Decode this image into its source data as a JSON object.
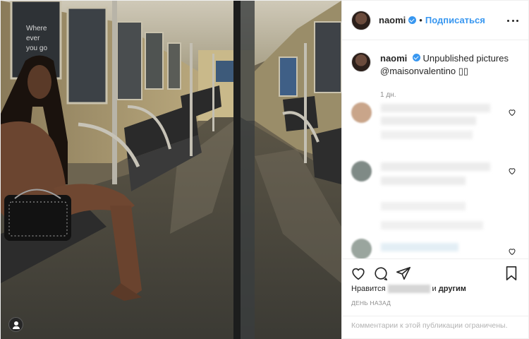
{
  "header": {
    "username": "naomi",
    "follow_label": "Подписаться",
    "dot": "•"
  },
  "caption": {
    "username": "naomi",
    "text": "Unpublished pictures",
    "mention": "@maisonvalentino",
    "emoji": "▯▯",
    "time": "1 дн."
  },
  "photo": {
    "sign_text": "Where ever you go"
  },
  "likes": {
    "prefix": "Нравится",
    "suffix": "и",
    "others": "другим"
  },
  "post_date": "ДЕНЬ НАЗАД",
  "comments_disabled": "Комментарии к этой публикации ограничены.",
  "icons": [
    "heart-icon",
    "comment-icon",
    "share-icon",
    "bookmark-icon",
    "more-options-icon",
    "tagged-user-icon"
  ],
  "colors": {
    "accent": "#3897f0",
    "text": "#262626",
    "muted": "#8e8e8e"
  }
}
